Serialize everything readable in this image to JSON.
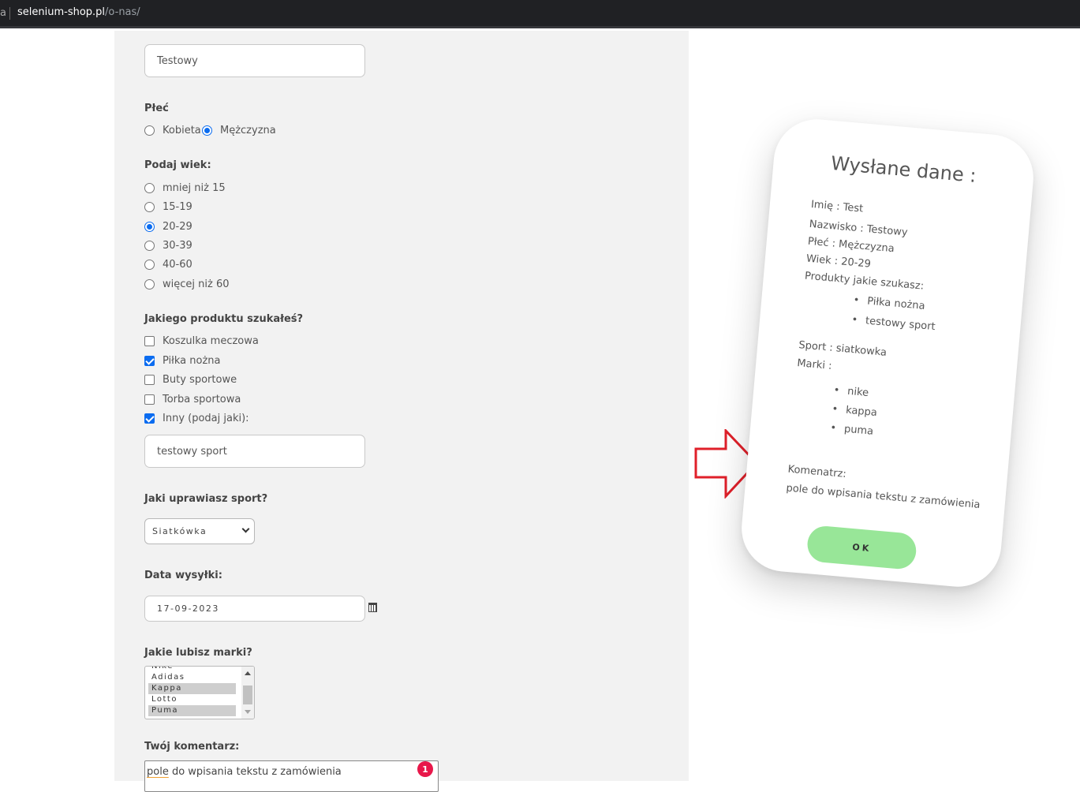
{
  "browser": {
    "tab_edge": "a",
    "url_host": "selenium-shop.pl",
    "url_path": "/o-nas/"
  },
  "form": {
    "surname_value": "Testowy",
    "gender": {
      "label": "Płeć",
      "options": [
        "Kobieta",
        "Mężczyzna"
      ],
      "selected": "Mężczyzna"
    },
    "age": {
      "label": "Podaj wiek:",
      "options": [
        "mniej niż 15",
        "15-19",
        "20-29",
        "30-39",
        "40-60",
        "więcej niż 60"
      ],
      "selected": "20-29"
    },
    "products": {
      "label": "Jakiego produktu szukałeś?",
      "options": [
        "Koszulka meczowa",
        "Piłka nożna",
        "Buty sportowe",
        "Torba sportowa",
        "Inny (podaj jaki):"
      ],
      "checked": [
        "Piłka nożna",
        "Inny (podaj jaki):"
      ],
      "other_value": "testowy sport"
    },
    "sport": {
      "label": "Jaki uprawiasz sport?",
      "selected": "Siatkówka"
    },
    "shipping_date": {
      "label": "Data wysyłki:",
      "value": "17-09-2023",
      "icon": "calendar-icon"
    },
    "brands": {
      "label": "Jakie lubisz marki?",
      "visible_options": [
        "Nike",
        "Adidas",
        "Kappa",
        "Lotto",
        "Puma"
      ],
      "selected": [
        "Kappa",
        "Puma"
      ]
    },
    "comment": {
      "label": "Twój komentarz:",
      "value_first_word": "pole",
      "value_rest": " do wpisania tekstu z zamówienia",
      "badge_count": "1",
      "badge_color": "#e8174a"
    }
  },
  "card": {
    "title": "Wysłane dane :",
    "name_line": "Imię : Test",
    "surname_line": "Nazwisko : Testowy",
    "gender_line": "Płeć : Mężczyzna",
    "age_line": "Wiek : 20-29",
    "products_heading": "Produkty jakie szukasz:",
    "products": [
      "Piłka nożna",
      "testowy sport"
    ],
    "sport_line": "Sport : siatkowka",
    "brands_heading": "Marki :",
    "brands": [
      "nike",
      "kappa",
      "puma"
    ],
    "comment_heading": "Komenatrz:",
    "comment_text": "pole do wpisania tekstu z zamówienia",
    "ok_label": "OK",
    "ok_color": "#98e698"
  },
  "annotation": {
    "arrow_color": "#e0202a",
    "icon": "outline-arrow-right-icon"
  }
}
